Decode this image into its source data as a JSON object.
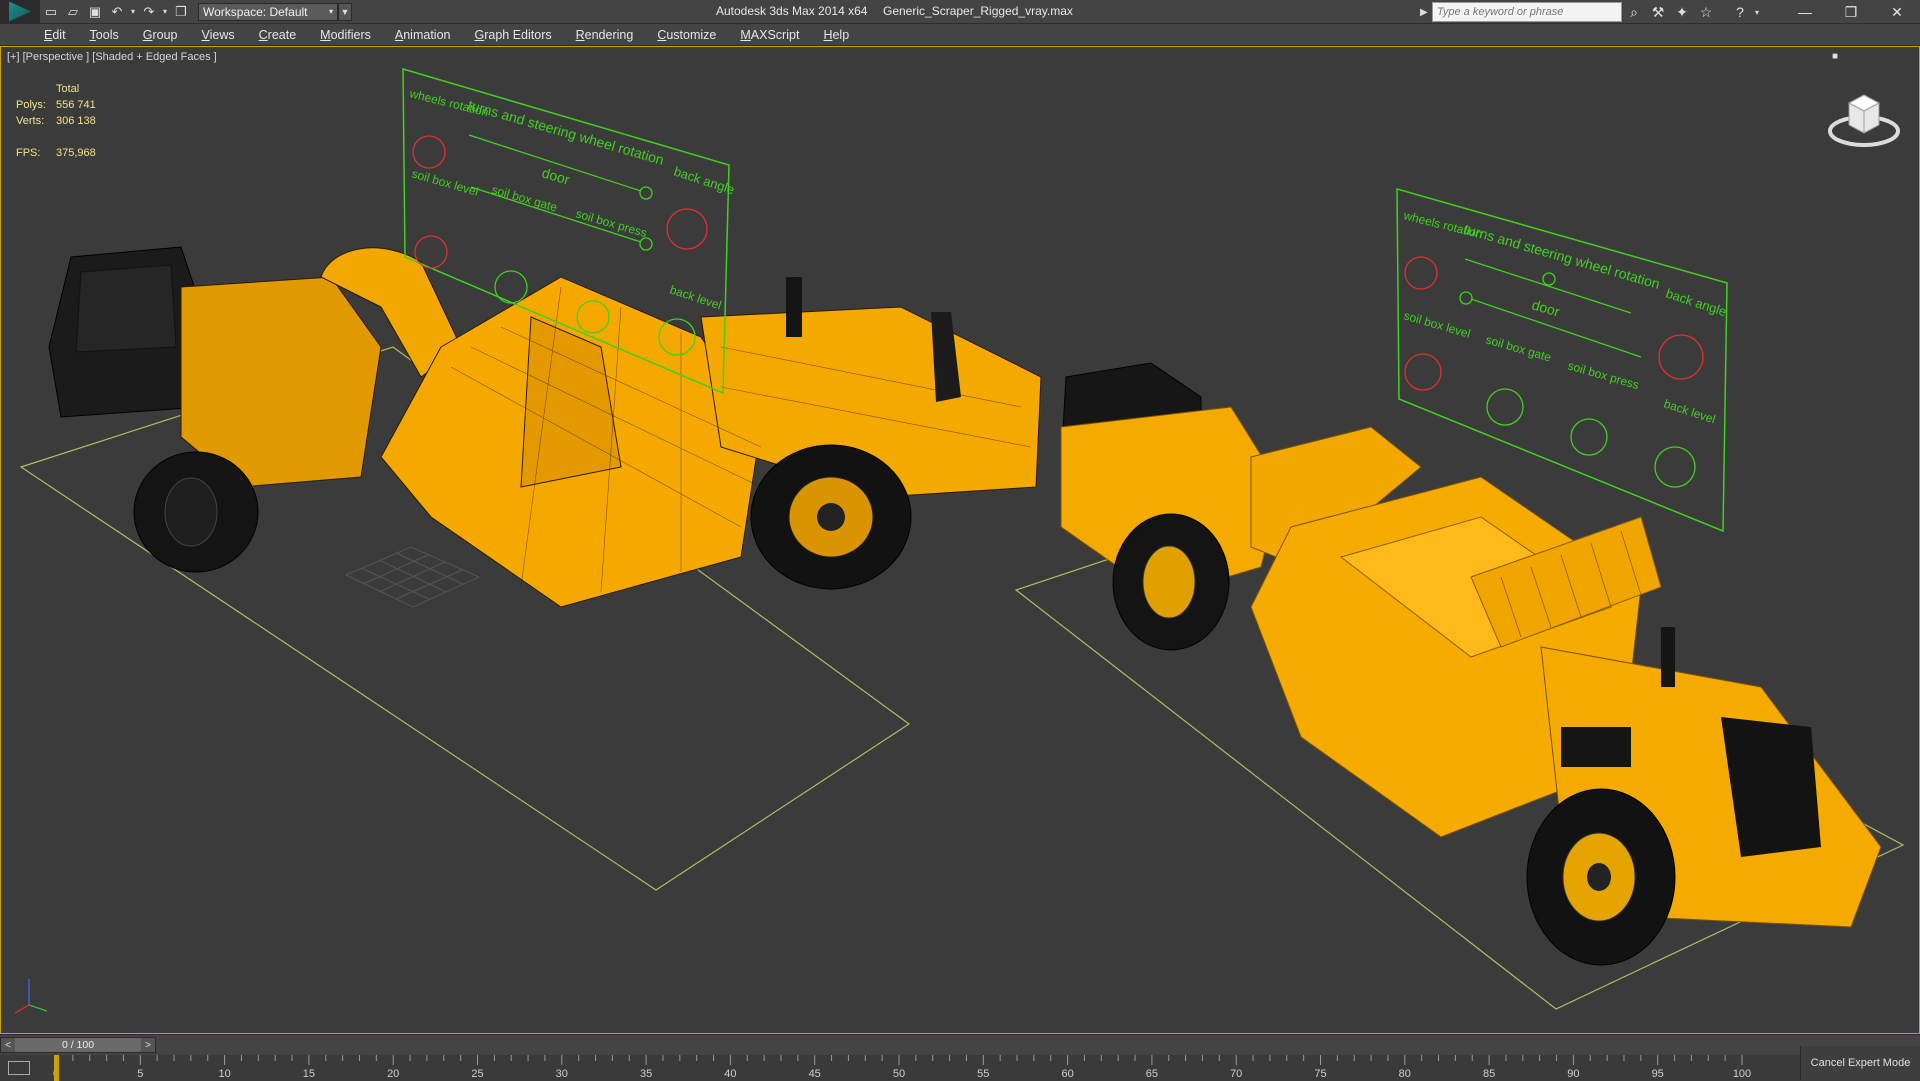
{
  "titlebar": {
    "app_title": "Autodesk 3ds Max  2014 x64",
    "file_name": "Generic_Scraper_Rigged_vray.max",
    "workspace_label": "Workspace: Default",
    "search_placeholder": "Type a keyword or phrase"
  },
  "menu": [
    "Edit",
    "Tools",
    "Group",
    "Views",
    "Create",
    "Modifiers",
    "Animation",
    "Graph Editors",
    "Rendering",
    "Customize",
    "MAXScript",
    "Help"
  ],
  "viewport": {
    "label": "[+] [Perspective ] [Shaded + Edged Faces ]",
    "stats": {
      "total_label": "Total",
      "polys_label": "Polys:",
      "polys_value": "556 741",
      "verts_label": "Verts:",
      "verts_value": "306 138",
      "fps_label": "FPS:",
      "fps_value": "375,968"
    },
    "rig_panel": {
      "wheels_rotation": "wheels rotation",
      "turns_steering": "turns and steering wheel rotation",
      "back_angle": "back angle",
      "door": "door",
      "soil_box_level": "soil box level",
      "soil_box_gate": "soil box gate",
      "soil_box_press": "soil box press",
      "back_level": "back level"
    }
  },
  "timeline": {
    "time_value": "0 / 100",
    "ticks": [
      0,
      5,
      10,
      15,
      20,
      25,
      30,
      35,
      40,
      45,
      50,
      55,
      60,
      65,
      70,
      75,
      80,
      85,
      90,
      95,
      100
    ],
    "expert_mode": "Cancel Expert Mode"
  },
  "colors": {
    "accent": "#c7a400",
    "machine": "#f5a900",
    "rig_green": "#40d020",
    "rig_red": "#e03030",
    "stats_text": "#efe48a"
  }
}
